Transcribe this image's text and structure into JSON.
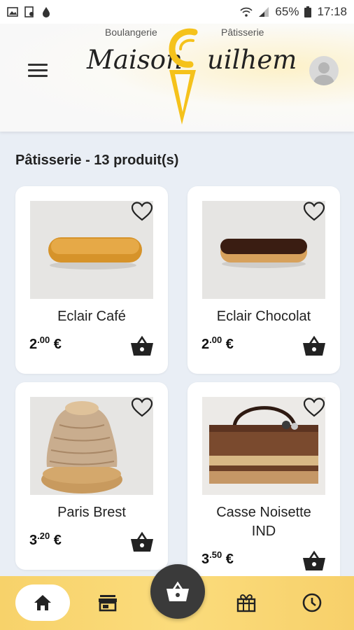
{
  "status_bar": {
    "battery": "65%",
    "time": "17:18",
    "icons": [
      "image-icon",
      "document-icon",
      "droplet-icon",
      "wifi-icon",
      "signal-icon",
      "battery-icon"
    ]
  },
  "header": {
    "brand_left_sub": "Boulangerie",
    "brand_right_sub": "Pâtisserie",
    "brand_name_left": "Maison",
    "brand_name_right": "uilhem",
    "brand_accent_color": "#f5c21b",
    "menu_icon": "menu-icon",
    "avatar_icon": "user-avatar-icon"
  },
  "section": {
    "title": "Pâtisserie - 13 produit(s)"
  },
  "products": [
    {
      "name": "Eclair Café",
      "price_int": "2",
      "price_dec": ".00",
      "currency": "€"
    },
    {
      "name": "Eclair Chocolat",
      "price_int": "2",
      "price_dec": ".00",
      "currency": "€"
    },
    {
      "name": "Paris Brest",
      "price_int": "3",
      "price_dec": ".20",
      "currency": "€"
    },
    {
      "name": "Casse Noisette IND",
      "price_int": "3",
      "price_dec": ".50",
      "currency": "€"
    }
  ],
  "bottom_nav": {
    "items": [
      "home-icon",
      "store-icon",
      "basket-icon",
      "gift-icon",
      "clock-icon"
    ],
    "active": "home",
    "bar_color": "#f9d673",
    "fab_color": "#3a3a3a"
  }
}
